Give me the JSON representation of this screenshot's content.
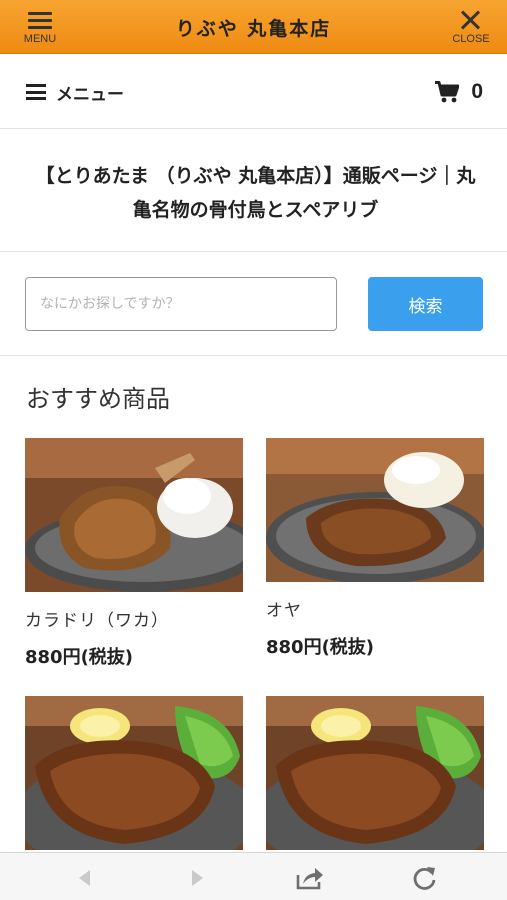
{
  "topbar": {
    "menu_label": "MENU",
    "close_label": "CLOSE",
    "shop_name": "りぶや 丸亀本店",
    "bar_color": "#f29a22"
  },
  "menubar": {
    "menu_label": "メニュー",
    "cart_count": "0"
  },
  "page_heading": "【とりあたま （りぶや 丸亀本店）】通販ページ｜丸亀名物の骨付鳥とスペアリブ",
  "search": {
    "placeholder": "なにかお探しですか？",
    "button_label": "検索",
    "button_color": "#3aa0ee"
  },
  "recommended": {
    "title": "おすすめ商品",
    "products": [
      {
        "name": "カラドリ（ワカ）",
        "price": "880円(税抜)",
        "image": "chicken-leg-photo"
      },
      {
        "name": "オヤ",
        "price": "880円(税抜)",
        "image": "chicken-leg-photo"
      },
      {
        "name": "",
        "price": "",
        "image": "spare-rib-photo"
      },
      {
        "name": "",
        "price": "",
        "image": "spare-rib-photo"
      }
    ]
  },
  "browser_bar": {
    "icons": [
      "back-arrow-icon",
      "forward-arrow-icon",
      "share-icon",
      "reload-icon"
    ]
  }
}
